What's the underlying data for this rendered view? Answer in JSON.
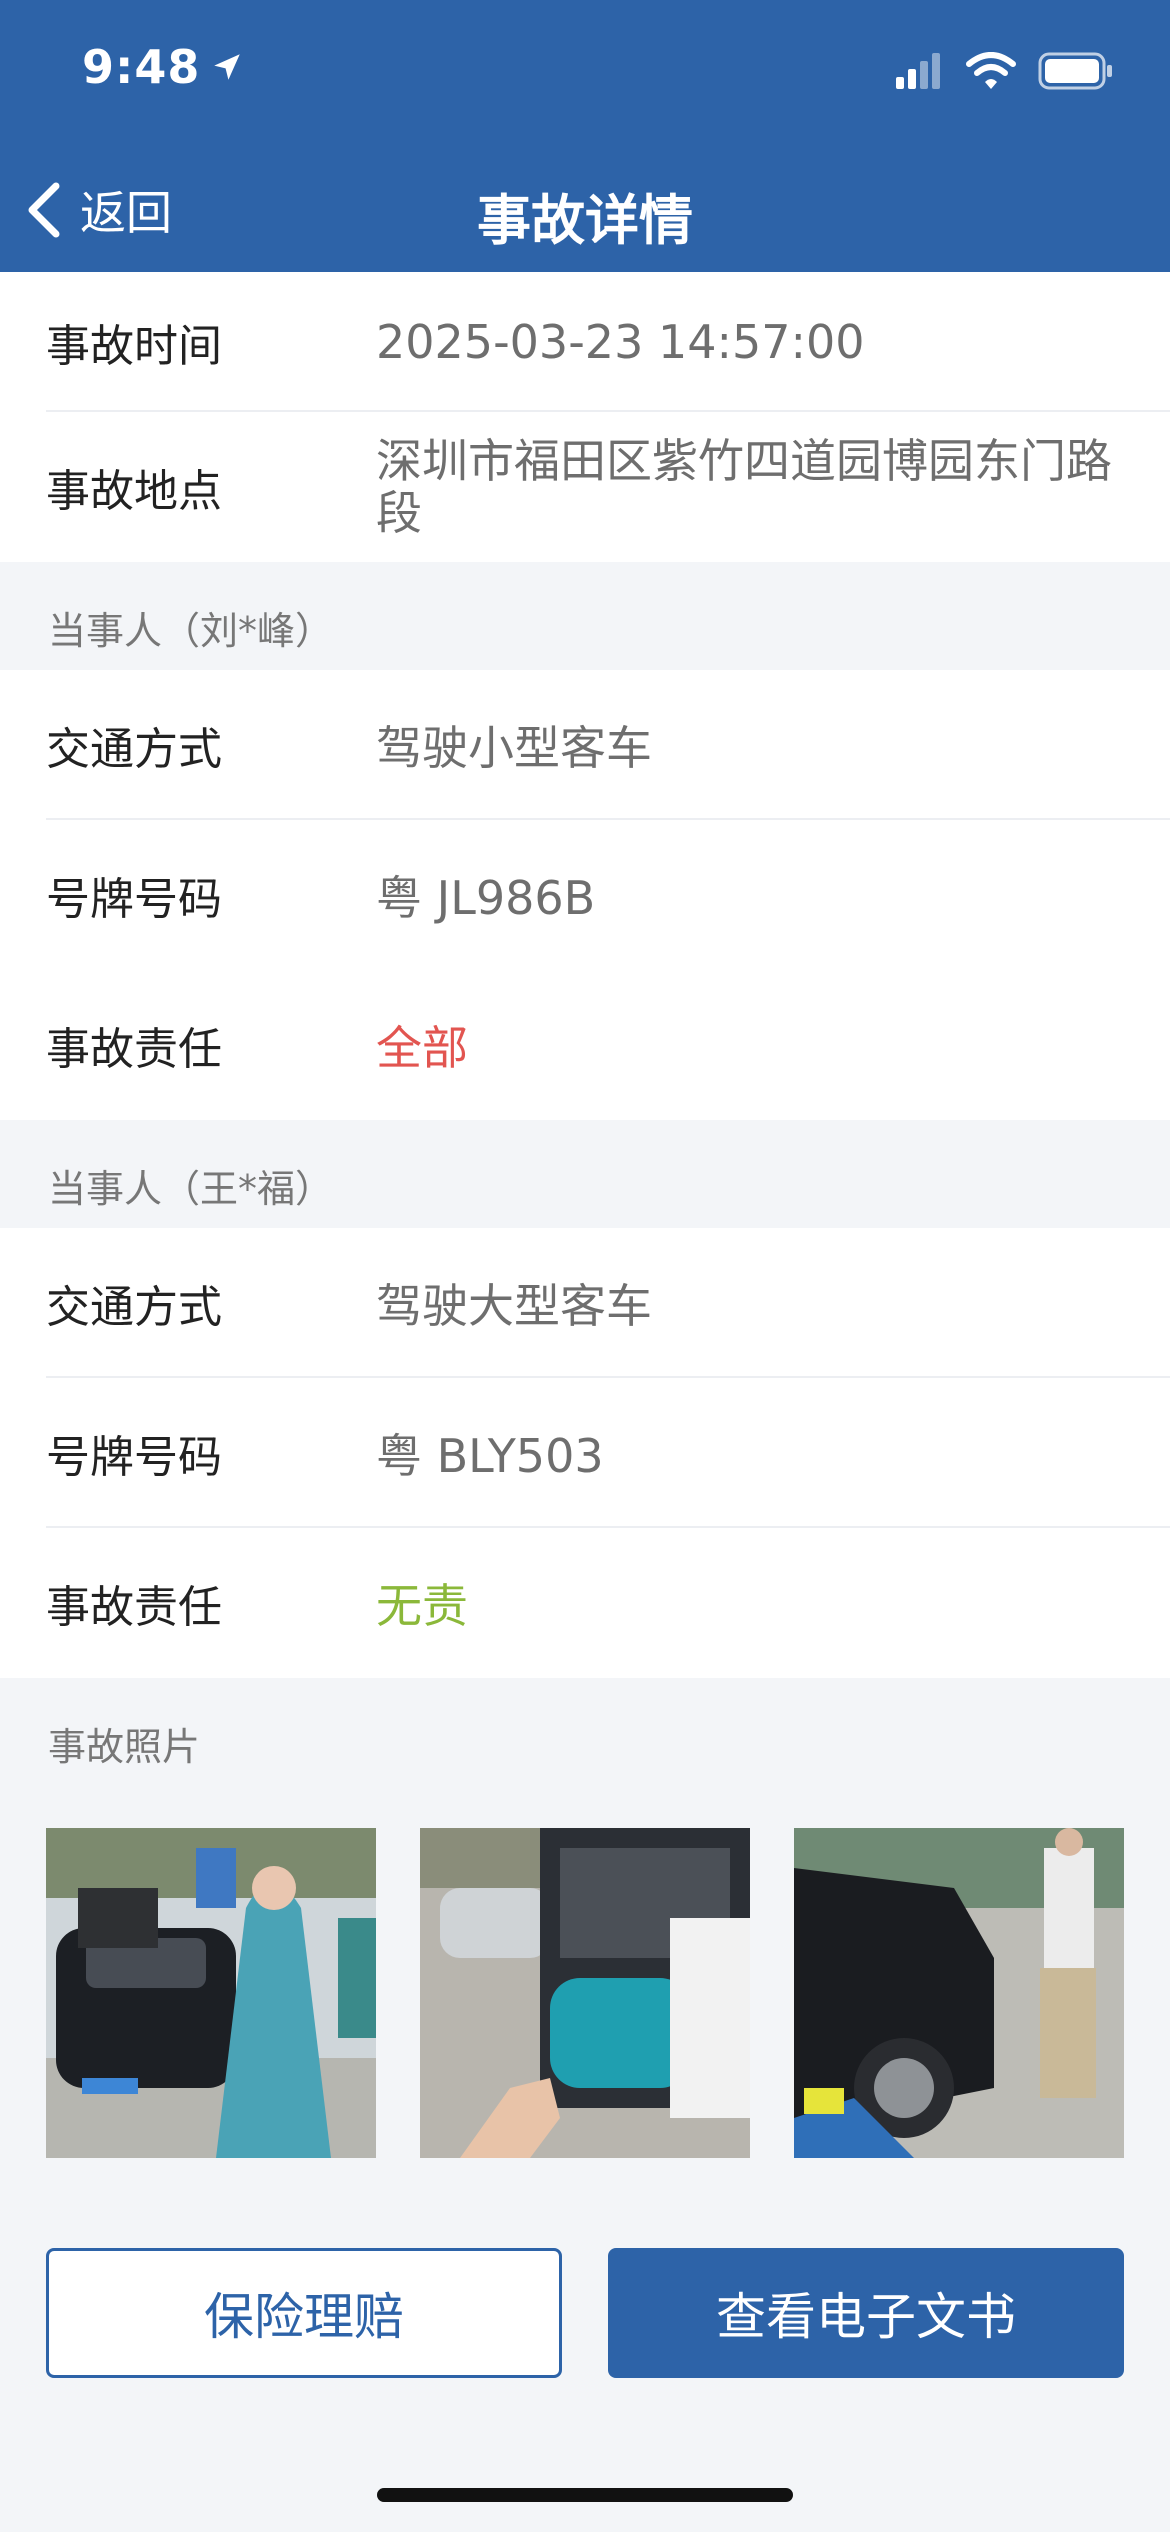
{
  "status_bar": {
    "time": "9:48"
  },
  "nav": {
    "back_label": "返回",
    "title": "事故详情"
  },
  "accident": {
    "time_label": "事故时间",
    "time_value": "2025-03-23 14:57:00",
    "place_label": "事故地点",
    "place_value": "深圳市福田区紫竹四道园博园东门路段"
  },
  "party1": {
    "header": "当事人（刘*峰）",
    "transport_label": "交通方式",
    "transport_value": "驾驶小型客车",
    "plate_label": "号牌号码",
    "plate_value": "粤 JL986B",
    "liability_label": "事故责任",
    "liability_value": "全部"
  },
  "party2": {
    "header": "当事人（王*福）",
    "transport_label": "交通方式",
    "transport_value": "驾驶大型客车",
    "plate_label": "号牌号码",
    "plate_value": "粤 BLY503",
    "liability_label": "事故责任",
    "liability_value": "无责"
  },
  "photos": {
    "title": "事故照片",
    "items": [
      "photo-black-sedan",
      "photo-teal-bus",
      "photo-car-damage"
    ]
  },
  "actions": {
    "insurance_label": "保险理赔",
    "document_label": "查看电子文书"
  },
  "colors": {
    "primary": "#2d63a8",
    "liability_full": "#e25550",
    "liability_none": "#8bb83a",
    "page_background": "#f3f5f8"
  }
}
